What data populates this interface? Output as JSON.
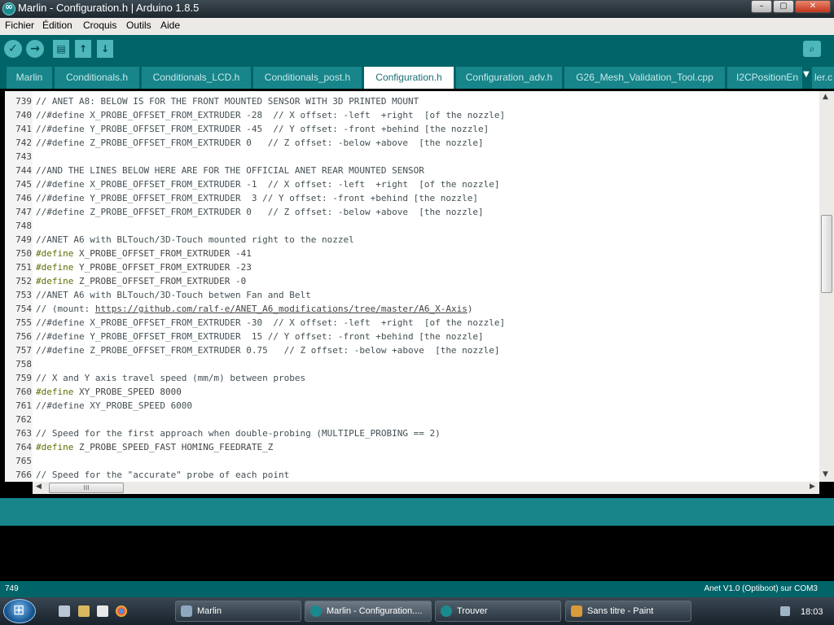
{
  "window": {
    "title": "Marlin - Configuration.h | Arduino 1.8.5",
    "controls": {
      "minimize": "–",
      "maximize": "▢",
      "close": "✕"
    }
  },
  "menu": [
    "Fichier",
    "Édition",
    "Croquis",
    "Outils",
    "Aide"
  ],
  "toolbar": {
    "verify_icon": "✓",
    "upload_icon": "→",
    "new_icon": "▤",
    "open_icon": "↑",
    "save_icon": "↓",
    "serial_icon": "⌕"
  },
  "tabs": [
    {
      "label": "Marlin",
      "active": false
    },
    {
      "label": "Conditionals.h",
      "active": false
    },
    {
      "label": "Conditionals_LCD.h",
      "active": false
    },
    {
      "label": "Conditionals_post.h",
      "active": false
    },
    {
      "label": "Configuration.h",
      "active": true
    },
    {
      "label": "Configuration_adv.h",
      "active": false
    },
    {
      "label": "G26_Mesh_Validation_Tool.cpp",
      "active": false
    },
    {
      "label": "I2CPositionEn",
      "active": false
    },
    {
      "label": "ler.c",
      "active": false
    }
  ],
  "tab_menu_icon": "▼",
  "code_lines": [
    {
      "num": "739",
      "parts": [
        {
          "t": "txt",
          "v": "// ANET A8: BELOW IS FOR THE FRONT MOUNTED SENSOR WITH 3D PRINTED MOUNT"
        }
      ]
    },
    {
      "num": "740",
      "parts": [
        {
          "t": "txt",
          "v": "//#define X_PROBE_OFFSET_FROM_EXTRUDER -28  // X offset: -left  +right  [of the nozzle]"
        }
      ]
    },
    {
      "num": "741",
      "parts": [
        {
          "t": "txt",
          "v": "//#define Y_PROBE_OFFSET_FROM_EXTRUDER -45  // Y offset: -front +behind [the nozzle]"
        }
      ]
    },
    {
      "num": "742",
      "parts": [
        {
          "t": "txt",
          "v": "//#define Z_PROBE_OFFSET_FROM_EXTRUDER 0   // Z offset: -below +above  [the nozzle]"
        }
      ]
    },
    {
      "num": "743",
      "parts": []
    },
    {
      "num": "744",
      "parts": [
        {
          "t": "txt",
          "v": "//AND THE LINES BELOW HERE ARE FOR THE OFFICIAL ANET REAR MOUNTED SENSOR"
        }
      ]
    },
    {
      "num": "745",
      "parts": [
        {
          "t": "txt",
          "v": "//#define X_PROBE_OFFSET_FROM_EXTRUDER -1  // X offset: -left  +right  [of the nozzle]"
        }
      ]
    },
    {
      "num": "746",
      "parts": [
        {
          "t": "txt",
          "v": "//#define Y_PROBE_OFFSET_FROM_EXTRUDER  3 // Y offset: -front +behind [the nozzle]"
        }
      ]
    },
    {
      "num": "747",
      "parts": [
        {
          "t": "txt",
          "v": "//#define Z_PROBE_OFFSET_FROM_EXTRUDER 0   // Z offset: -below +above  [the nozzle]"
        }
      ]
    },
    {
      "num": "748",
      "parts": []
    },
    {
      "num": "749",
      "parts": [
        {
          "t": "txt",
          "v": "//ANET A6 with BLTouch/3D-Touch mounted right to the nozzel"
        }
      ]
    },
    {
      "num": "750",
      "parts": [
        {
          "t": "kw",
          "v": "#define"
        },
        {
          "t": "plain",
          "v": " X_PROBE_OFFSET_FROM_EXTRUDER -41"
        }
      ]
    },
    {
      "num": "751",
      "parts": [
        {
          "t": "kw",
          "v": "#define"
        },
        {
          "t": "plain",
          "v": " Y_PROBE_OFFSET_FROM_EXTRUDER -23"
        }
      ]
    },
    {
      "num": "752",
      "parts": [
        {
          "t": "kw",
          "v": "#define"
        },
        {
          "t": "plain",
          "v": " Z_PROBE_OFFSET_FROM_EXTRUDER -0"
        }
      ]
    },
    {
      "num": "753",
      "parts": [
        {
          "t": "txt",
          "v": "//ANET A6 with BLTouch/3D-Touch betwen Fan and Belt"
        }
      ]
    },
    {
      "num": "754",
      "parts": [
        {
          "t": "txt",
          "v": "// (mount: "
        },
        {
          "t": "link",
          "v": "https://github.com/ralf-e/ANET_A6_modifications/tree/master/A6_X-Axis"
        },
        {
          "t": "txt",
          "v": ")"
        }
      ]
    },
    {
      "num": "755",
      "parts": [
        {
          "t": "txt",
          "v": "//#define X_PROBE_OFFSET_FROM_EXTRUDER -30  // X offset: -left  +right  [of the nozzle]"
        }
      ]
    },
    {
      "num": "756",
      "parts": [
        {
          "t": "txt",
          "v": "//#define Y_PROBE_OFFSET_FROM_EXTRUDER  15 // Y offset: -front +behind [the nozzle]"
        }
      ]
    },
    {
      "num": "757",
      "parts": [
        {
          "t": "txt",
          "v": "//#define Z_PROBE_OFFSET_FROM_EXTRUDER 0.75   // Z offset: -below +above  [the nozzle]"
        }
      ]
    },
    {
      "num": "758",
      "parts": []
    },
    {
      "num": "759",
      "parts": [
        {
          "t": "txt",
          "v": "// X and Y axis travel speed (mm/m) between probes"
        }
      ]
    },
    {
      "num": "760",
      "parts": [
        {
          "t": "kw",
          "v": "#define"
        },
        {
          "t": "plain",
          "v": " XY_PROBE_SPEED 8000"
        }
      ]
    },
    {
      "num": "761",
      "parts": [
        {
          "t": "txt",
          "v": "//#define XY_PROBE_SPEED 6000"
        }
      ]
    },
    {
      "num": "762",
      "parts": []
    },
    {
      "num": "763",
      "parts": [
        {
          "t": "txt",
          "v": "// Speed for the first approach when double-probing (MULTIPLE_PROBING == 2)"
        }
      ]
    },
    {
      "num": "764",
      "parts": [
        {
          "t": "kw",
          "v": "#define"
        },
        {
          "t": "plain",
          "v": " Z_PROBE_SPEED_FAST HOMING_FEEDRATE_Z"
        }
      ]
    },
    {
      "num": "765",
      "parts": []
    },
    {
      "num": "766",
      "parts": [
        {
          "t": "txt",
          "v": "// Speed for the \"accurate\" probe of each point"
        }
      ]
    }
  ],
  "scroll": {
    "up": "▲",
    "down": "▼",
    "left": "◀",
    "right": "▶",
    "vgrip": "≡",
    "hgrip": "III"
  },
  "footer": {
    "line": "749",
    "board": "Anet V1.0 (Optiboot) sur COM3"
  },
  "colors": {
    "teal_dark": "#006468",
    "teal_mid": "#17858a",
    "keyword": "#5e6d03"
  },
  "taskbar": {
    "start_icon": "windows-orb",
    "quick_launch": [
      "show-desktop-icon",
      "explorer-icon",
      "app-icon",
      "chrome-icon"
    ],
    "tasks": [
      {
        "label": "Marlin",
        "icon": "folder-icon",
        "active": false
      },
      {
        "label": "Marlin - Configuration....",
        "icon": "arduino-icon",
        "active": true
      },
      {
        "label": "Trouver",
        "icon": "arduino-icon",
        "active": false
      },
      {
        "label": "Sans titre - Paint",
        "icon": "paint-icon",
        "active": false
      }
    ],
    "clock": "18:03"
  }
}
